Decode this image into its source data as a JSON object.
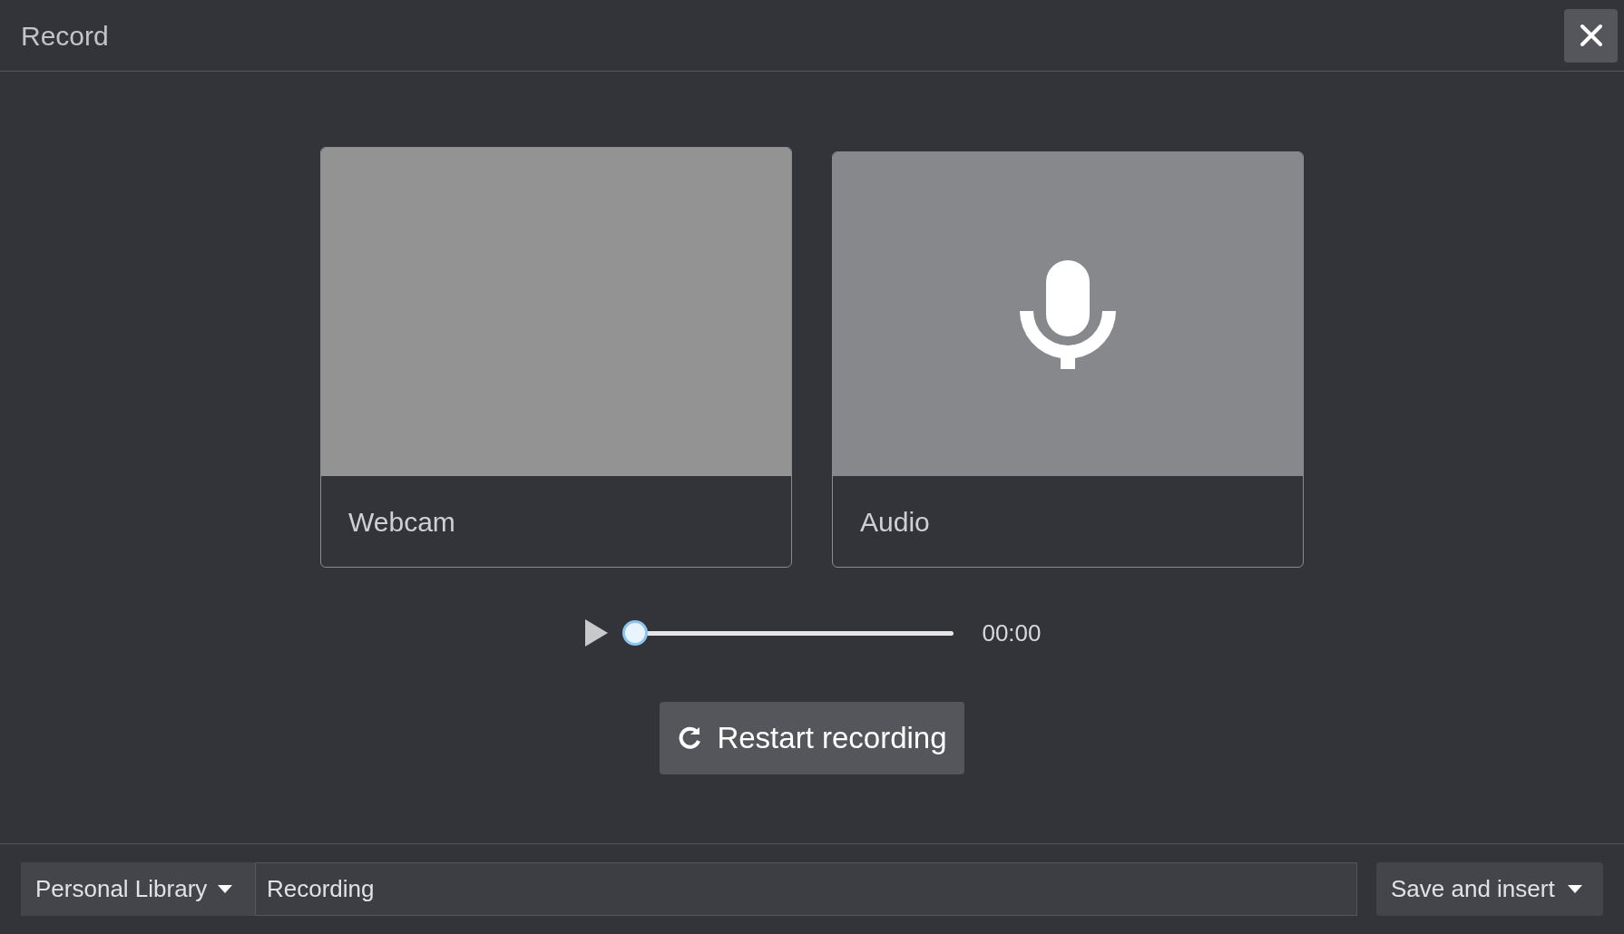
{
  "window": {
    "title": "Record"
  },
  "sources": [
    {
      "kind": "webcam",
      "label": "Webcam"
    },
    {
      "kind": "audio",
      "label": "Audio"
    }
  ],
  "player": {
    "level": 0,
    "time": "00:00"
  },
  "restart_button": {
    "label": "Restart recording"
  },
  "footer": {
    "library": "Personal Library",
    "name_value": "Recording",
    "save_button": "Save and insert"
  }
}
